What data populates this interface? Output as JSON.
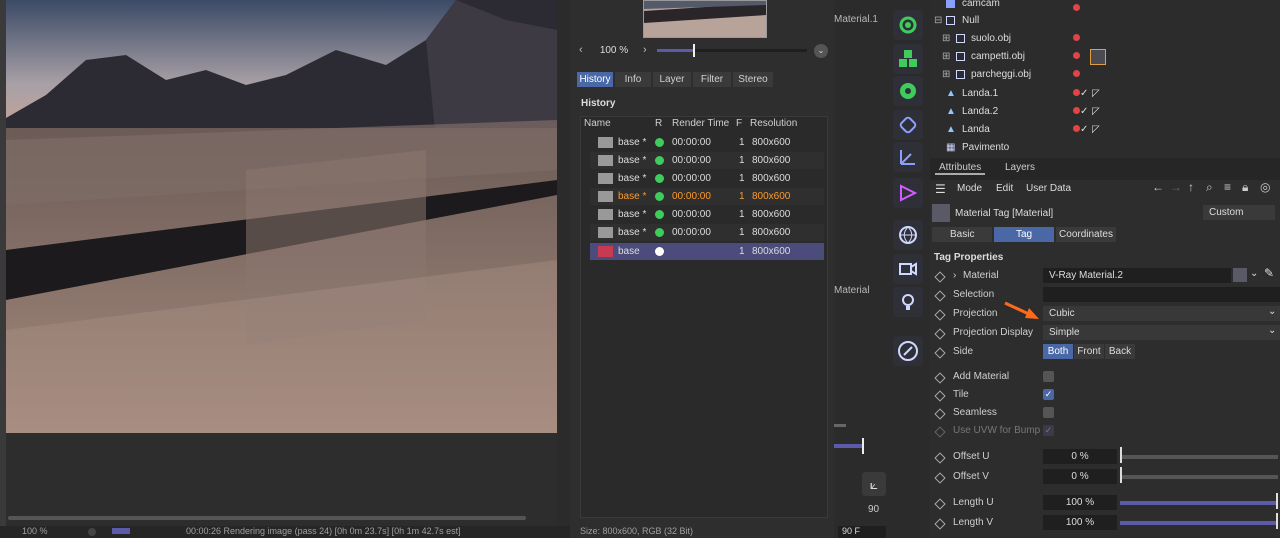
{
  "viewer": {
    "zoom": "100 %",
    "tabs": [
      "History",
      "Info",
      "Layer",
      "Filter",
      "Stereo"
    ],
    "active_tab": "History",
    "history_title": "History",
    "columns": [
      "Name",
      "R",
      "Render Time",
      "F",
      "Resolution"
    ],
    "rows": [
      {
        "name": "base *",
        "time": "00:00:00",
        "frame": "1",
        "res": "800x600"
      },
      {
        "name": "base *",
        "time": "00:00:00",
        "frame": "1",
        "res": "800x600"
      },
      {
        "name": "base *",
        "time": "00:00:00",
        "frame": "1",
        "res": "800x600"
      },
      {
        "name": "base *",
        "time": "00:00:00",
        "frame": "1",
        "res": "800x600"
      },
      {
        "name": "base *",
        "time": "00:00:00",
        "frame": "1",
        "res": "800x600"
      },
      {
        "name": "base *",
        "time": "00:00:00",
        "frame": "1",
        "res": "800x600"
      },
      {
        "name": "base",
        "time": "",
        "frame": "1",
        "res": "800x600"
      }
    ],
    "status": "00:00:26 Rendering image (pass 24) [0h  0m 23.7s] [0h  1m 42.7s est]",
    "bottom_zoom": "100 %",
    "size_info": "Size: 800x600, RGB (32 Bit)"
  },
  "middle": {
    "label_top": "Material.1",
    "label_mid": "Material",
    "frame_value": "90",
    "frame_field": "90 F"
  },
  "objects": [
    {
      "name": "camcam"
    },
    {
      "name": "Null"
    },
    {
      "name": "suolo.obj"
    },
    {
      "name": "campetti.obj"
    },
    {
      "name": "parcheggi.obj"
    },
    {
      "name": "Landa.1"
    },
    {
      "name": "Landa.2"
    },
    {
      "name": "Landa"
    },
    {
      "name": "Pavimento"
    }
  ],
  "attributes": {
    "tabs": [
      "Attributes",
      "Layers"
    ],
    "menu": [
      "Mode",
      "Edit",
      "User Data"
    ],
    "tag_title": "Material Tag [Material]",
    "preset": "Custom",
    "subtabs": [
      "Basic",
      "Tag",
      "Coordinates"
    ],
    "section": "Tag Properties",
    "material_label": "Material",
    "material_value": "V-Ray Material.2",
    "selection_label": "Selection",
    "projection_label": "Projection",
    "projection_value": "Cubic",
    "projection_display_label": "Projection Display",
    "projection_display_value": "Simple",
    "side_label": "Side",
    "side_options": [
      "Both",
      "Front",
      "Back"
    ],
    "add_material_label": "Add Material",
    "tile_label": "Tile",
    "seamless_label": "Seamless",
    "use_uvw_label": "Use UVW for Bump",
    "offset_u_label": "Offset U",
    "offset_u_value": "0 %",
    "offset_v_label": "Offset V",
    "offset_v_value": "0 %",
    "length_u_label": "Length U",
    "length_u_value": "100 %",
    "length_v_label": "Length V",
    "length_v_value": "100 %"
  },
  "colors": {
    "accent": "#4a68a6",
    "annotation_arrow": "#ff6a1a",
    "render_ok": "#3fcc5d"
  }
}
